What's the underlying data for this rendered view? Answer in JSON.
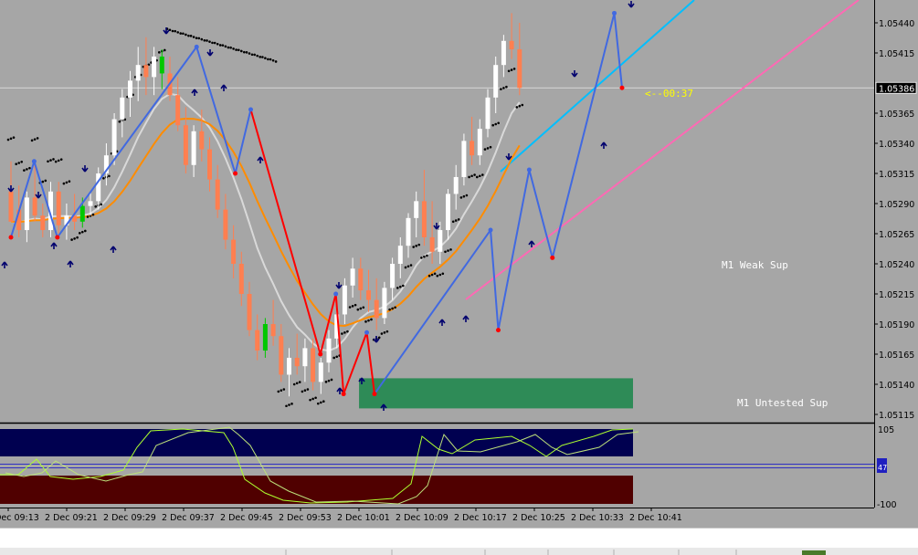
{
  "chart_data": {
    "type": "candlestick",
    "symbol_timeframe": "M1",
    "price_axis": {
      "min": 1.05105,
      "max": 1.0556,
      "ticks": [
        "1.05440",
        "1.05415",
        "1.05365",
        "1.05340",
        "1.05315",
        "1.05290",
        "1.05265",
        "1.05240",
        "1.05215",
        "1.05190",
        "1.05165",
        "1.05140",
        "1.05115"
      ],
      "hidden_tick": "1.05390",
      "current_price": "1.05386"
    },
    "time_axis": {
      "labels": [
        "2 Dec 09:13",
        "2 Dec 09:21",
        "2 Dec 09:29",
        "2 Dec 09:37",
        "2 Dec 09:45",
        "2 Dec 09:53",
        "2 Dec 10:01",
        "2 Dec 10:09",
        "2 Dec 10:17",
        "2 Dec 10:25",
        "2 Dec 10:33",
        "2 Dec 10:41"
      ]
    },
    "bar_countdown": "<--00:37",
    "zones": [
      {
        "label": "M1 Weak Sup"
      },
      {
        "label": "M1 Untested Sup",
        "top": 1.05145,
        "bottom": 1.0512
      }
    ],
    "candles": [
      [
        1.053,
        1.05325,
        1.05282,
        1.05275,
        "d"
      ],
      [
        1.05285,
        1.05305,
        1.05262,
        1.05268,
        "d"
      ],
      [
        1.05268,
        1.053,
        1.05258,
        1.05295,
        "u"
      ],
      [
        1.05295,
        1.05325,
        1.05275,
        1.0528,
        "d"
      ],
      [
        1.0528,
        1.0529,
        1.05262,
        1.05268,
        "d"
      ],
      [
        1.05268,
        1.05308,
        1.05262,
        1.053,
        "u"
      ],
      [
        1.053,
        1.05308,
        1.05265,
        1.05272,
        "d"
      ],
      [
        1.05272,
        1.0529,
        1.0526,
        1.0528,
        "u"
      ],
      [
        1.0528,
        1.05298,
        1.05268,
        1.05275,
        "d"
      ],
      [
        1.05275,
        1.05295,
        1.0527,
        1.05288,
        "g"
      ],
      [
        1.05288,
        1.053,
        1.0528,
        1.05292,
        "u"
      ],
      [
        1.05292,
        1.0532,
        1.05285,
        1.05315,
        "u"
      ],
      [
        1.05315,
        1.0534,
        1.05305,
        1.0533,
        "u"
      ],
      [
        1.0533,
        1.05365,
        1.05322,
        1.0536,
        "u"
      ],
      [
        1.0536,
        1.05385,
        1.05345,
        1.05378,
        "u"
      ],
      [
        1.05378,
        1.054,
        1.05362,
        1.05392,
        "u"
      ],
      [
        1.05392,
        1.0542,
        1.05375,
        1.05405,
        "u"
      ],
      [
        1.05405,
        1.05428,
        1.0538,
        1.05395,
        "d"
      ],
      [
        1.05395,
        1.0542,
        1.0538,
        1.05412,
        "u"
      ],
      [
        1.05412,
        1.05418,
        1.05385,
        1.05398,
        "g"
      ],
      [
        1.05398,
        1.05412,
        1.05375,
        1.0538,
        "d"
      ],
      [
        1.0538,
        1.05395,
        1.0535,
        1.05355,
        "d"
      ],
      [
        1.05355,
        1.0537,
        1.05315,
        1.05322,
        "d"
      ],
      [
        1.05322,
        1.05355,
        1.05312,
        1.0535,
        "u"
      ],
      [
        1.0535,
        1.05368,
        1.05325,
        1.05335,
        "d"
      ],
      [
        1.05335,
        1.05345,
        1.053,
        1.0531,
        "d"
      ],
      [
        1.0531,
        1.05322,
        1.05278,
        1.05285,
        "d"
      ],
      [
        1.05285,
        1.05298,
        1.05252,
        1.0526,
        "d"
      ],
      [
        1.0526,
        1.05272,
        1.05228,
        1.0524,
        "d"
      ],
      [
        1.0524,
        1.0525,
        1.05205,
        1.05215,
        "d"
      ],
      [
        1.05215,
        1.05225,
        1.0518,
        1.05185,
        "d"
      ],
      [
        1.05185,
        1.05198,
        1.0516,
        1.05168,
        "d"
      ],
      [
        1.05168,
        1.05195,
        1.05162,
        1.0519,
        "g"
      ],
      [
        1.0519,
        1.0521,
        1.05172,
        1.0518,
        "d"
      ],
      [
        1.0518,
        1.0519,
        1.05142,
        1.05148,
        "d"
      ],
      [
        1.05148,
        1.0517,
        1.0513,
        1.05162,
        "u"
      ],
      [
        1.05162,
        1.05182,
        1.05148,
        1.05155,
        "d"
      ],
      [
        1.05155,
        1.05178,
        1.05142,
        1.0517,
        "u"
      ],
      [
        1.0517,
        1.05178,
        1.05135,
        1.05142,
        "d"
      ],
      [
        1.05142,
        1.05162,
        1.05132,
        1.05158,
        "u"
      ],
      [
        1.05158,
        1.05185,
        1.0515,
        1.05178,
        "u"
      ],
      [
        1.05178,
        1.05205,
        1.0517,
        1.05198,
        "u"
      ],
      [
        1.05198,
        1.05228,
        1.0519,
        1.05222,
        "u"
      ],
      [
        1.05222,
        1.05245,
        1.05212,
        1.05236,
        "u"
      ],
      [
        1.05236,
        1.05245,
        1.0521,
        1.05218,
        "d"
      ],
      [
        1.05218,
        1.05235,
        1.052,
        1.0521,
        "d"
      ],
      [
        1.0521,
        1.05228,
        1.05185,
        1.05195,
        "d"
      ],
      [
        1.05195,
        1.05225,
        1.0519,
        1.0522,
        "u"
      ],
      [
        1.0522,
        1.05245,
        1.0521,
        1.0524,
        "u"
      ],
      [
        1.0524,
        1.05262,
        1.05228,
        1.05255,
        "u"
      ],
      [
        1.05255,
        1.05282,
        1.05245,
        1.05278,
        "u"
      ],
      [
        1.05278,
        1.053,
        1.05262,
        1.05292,
        "u"
      ],
      [
        1.05292,
        1.05318,
        1.05255,
        1.05262,
        "d"
      ],
      [
        1.05262,
        1.05292,
        1.0524,
        1.0525,
        "d"
      ],
      [
        1.0525,
        1.05275,
        1.0524,
        1.05268,
        "u"
      ],
      [
        1.05268,
        1.05302,
        1.0526,
        1.05298,
        "u"
      ],
      [
        1.05298,
        1.05322,
        1.05285,
        1.05312,
        "u"
      ],
      [
        1.05312,
        1.05348,
        1.05305,
        1.05342,
        "u"
      ],
      [
        1.05342,
        1.05362,
        1.05322,
        1.0533,
        "d"
      ],
      [
        1.0533,
        1.0536,
        1.05322,
        1.05352,
        "u"
      ],
      [
        1.05352,
        1.05385,
        1.05345,
        1.05378,
        "u"
      ],
      [
        1.05378,
        1.05412,
        1.05365,
        1.05405,
        "u"
      ],
      [
        1.05405,
        1.0543,
        1.05395,
        1.05425,
        "u"
      ],
      [
        1.05425,
        1.05448,
        1.0541,
        1.05418,
        "d"
      ],
      [
        1.05418,
        1.0544,
        1.0538,
        1.05386,
        "d"
      ]
    ],
    "oscillator_panel": {
      "ticks": [
        "105",
        "47",
        "-100"
      ],
      "levels": [
        80,
        20
      ]
    },
    "colors": {
      "background": "#a6a6a6",
      "bull_candle": "#ffffff",
      "bear_candle": "#ff7f50",
      "green_candle": "#00c800",
      "zigzag_up": "#4169e1",
      "zigzag_down": "#ff0000",
      "ma_fast": "#d9d9d9",
      "ma_slow": "#ff8c00",
      "channel_upper": "#00bfff",
      "channel_lower": "#ff69b4",
      "zone": "#2e8b57",
      "osc_upper_band": "#000050",
      "osc_lower_band": "#500000",
      "osc_line": "#adff2f",
      "countdown": "#ffff00"
    }
  },
  "tab_bar": {}
}
